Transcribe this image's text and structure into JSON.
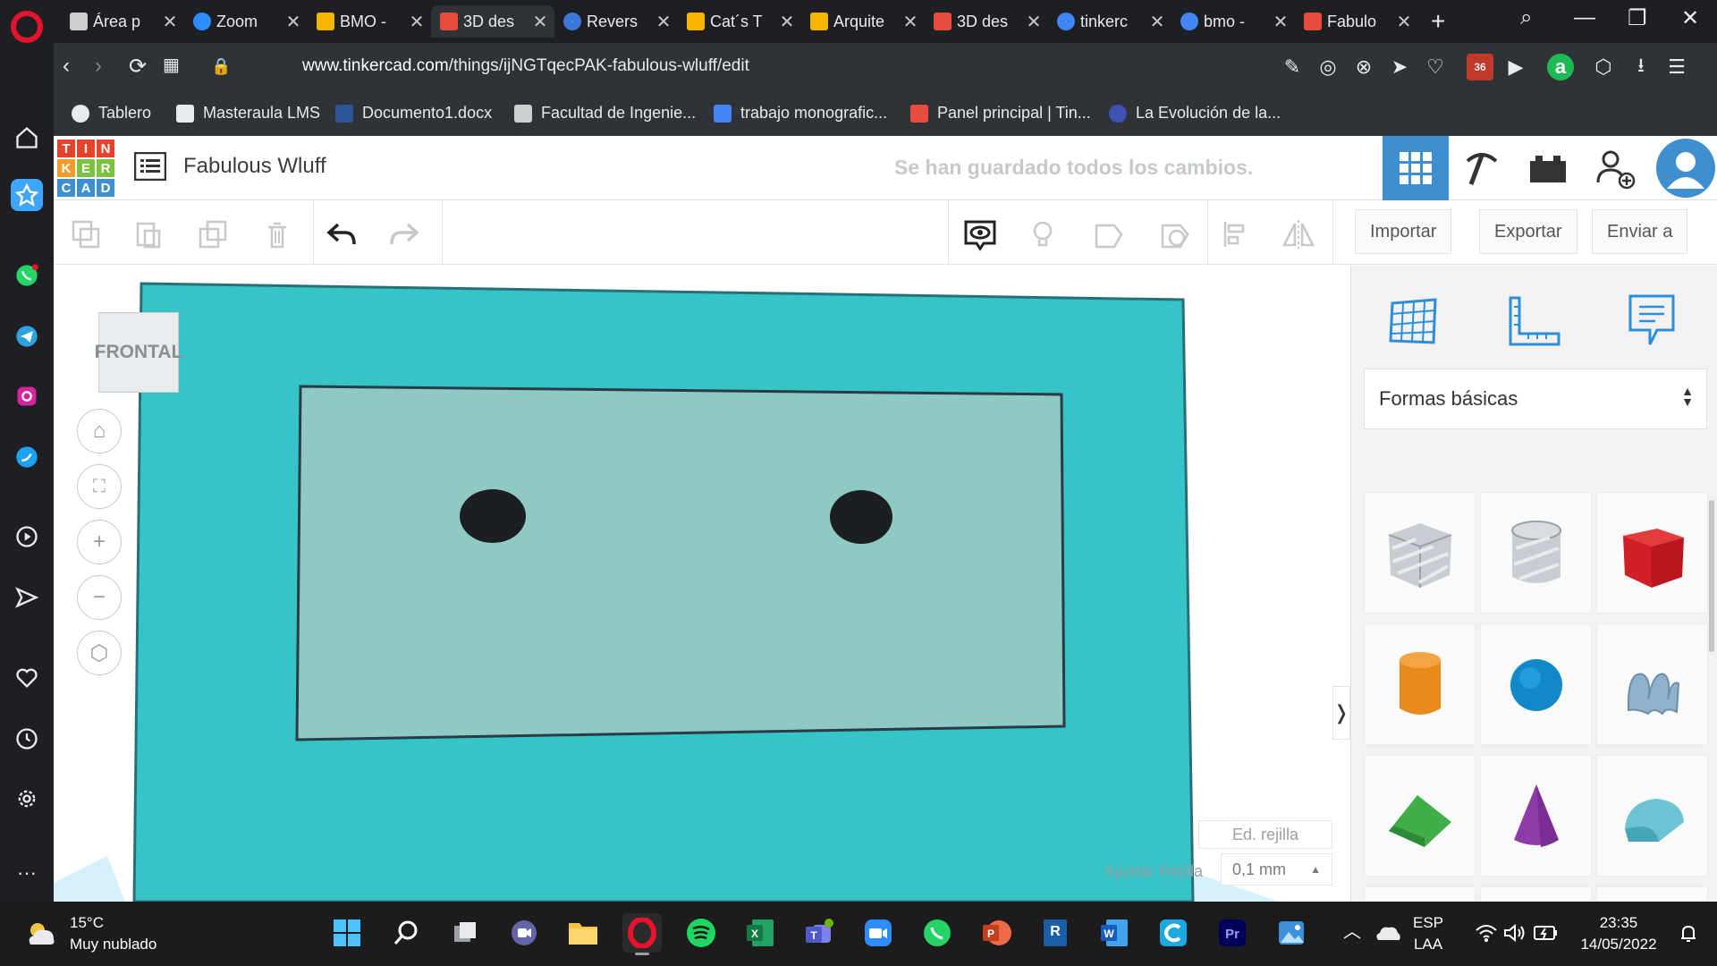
{
  "browser": {
    "tabs": [
      {
        "title": "Área p",
        "color": "#cfcfcf"
      },
      {
        "title": "Zoom",
        "color": "#2d8cff"
      },
      {
        "title": "BMO -",
        "color": "#f4b400"
      },
      {
        "title": "3D des",
        "color": "#e74c3c",
        "active": true
      },
      {
        "title": "Revers",
        "color": "#3c78d8"
      },
      {
        "title": "Cat´s T",
        "color": "#f4b400"
      },
      {
        "title": "Arquite",
        "color": "#f4b400"
      },
      {
        "title": "3D des",
        "color": "#e74c3c"
      },
      {
        "title": "tinkerc",
        "color": "#4285f4"
      },
      {
        "title": "bmo -",
        "color": "#4285f4"
      },
      {
        "title": "Fabulo",
        "color": "#e74c3c"
      }
    ],
    "url_domain": "www.tinkercad.com",
    "url_path": "/things/ijNGTqecPAK-fabulous-wluff/edit",
    "ublock_count": "36",
    "bookmarks": [
      {
        "label": "Tablero",
        "color": "#e8eaed"
      },
      {
        "label": "Masteraula LMS",
        "color": "#e8eaed"
      },
      {
        "label": "Documento1.docx",
        "color": "#2b579a"
      },
      {
        "label": "Facultad de Ingenie...",
        "color": "#cfcfcf"
      },
      {
        "label": "trabajo monografic...",
        "color": "#4285f4"
      },
      {
        "label": "Panel principal | Tin...",
        "color": "#e74c3c"
      },
      {
        "label": "La Evolución de la...",
        "color": "#3f51b5"
      }
    ]
  },
  "tinkercad": {
    "logo_letters": [
      "T",
      "I",
      "N",
      "K",
      "E",
      "R",
      "C",
      "A",
      "D"
    ],
    "project_title": "Fabulous Wluff",
    "save_status": "Se han guardado todos los cambios.",
    "toolbar": {
      "import_label": "Importar",
      "export_label": "Exportar",
      "send_label": "Enviar a"
    },
    "viewcube_label": "FRONTAL",
    "grid": {
      "edit_label": "Ed. rejilla",
      "snap_label": "Ajustar Rejilla",
      "snap_value": "0,1 mm"
    },
    "shapes_category": "Formas básicas",
    "colors": {
      "brand_blue": "#3e8fcf",
      "body_teal": "#35c4c8",
      "screen_teal": "#8ec9c5",
      "eye": "#1b1f22"
    }
  },
  "taskbar": {
    "temperature": "15°C",
    "weather": "Muy nublado",
    "lang_top": "ESP",
    "lang_bottom": "LAA",
    "time": "23:35",
    "date": "14/05/2022"
  }
}
